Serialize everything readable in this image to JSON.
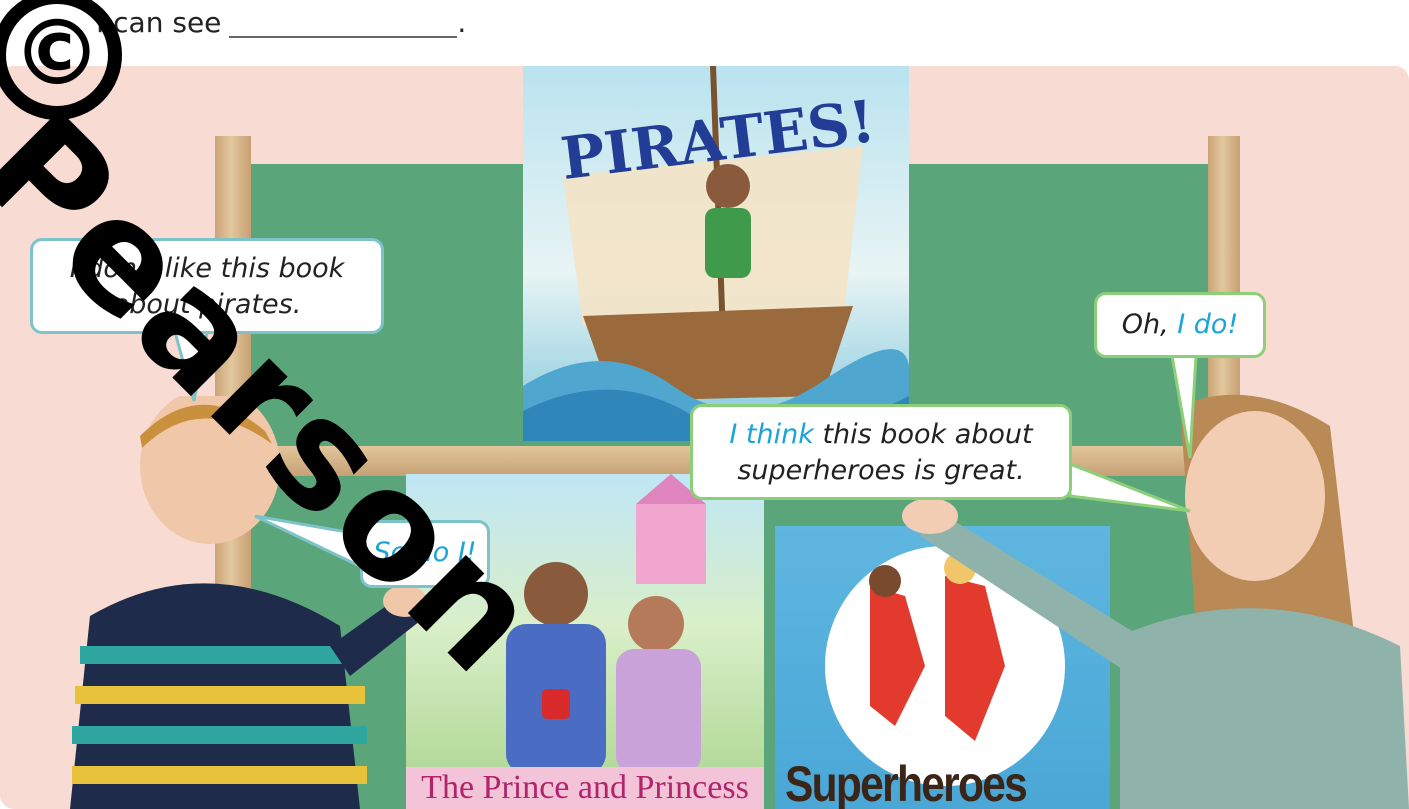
{
  "prompt": {
    "lead": "I can see",
    "end": "."
  },
  "bubbles": {
    "boy_top": {
      "line1": "I don’t like this book",
      "line2": "about pirates."
    },
    "boy_low": {
      "text": "So do I!"
    },
    "girl_top": {
      "pre": "Oh, ",
      "hl": "I do!"
    },
    "girl_low": {
      "hl": "I think",
      "rest1": " this book about",
      "line2": "superheroes is great."
    }
  },
  "books": {
    "pirates": {
      "title": "PIRATES!"
    },
    "prince": {
      "title": "The Prince and Princess"
    },
    "heroes": {
      "title": "Superheroes"
    }
  },
  "watermark": {
    "text": "Pearson",
    "symbol": "©"
  },
  "colors": {
    "background": "#f8dcd3",
    "board": "#5aa57a",
    "bubble_border_boy": "#7dc3c9",
    "bubble_border_girl": "#8ccf79",
    "highlight": "#1aa4d8"
  }
}
